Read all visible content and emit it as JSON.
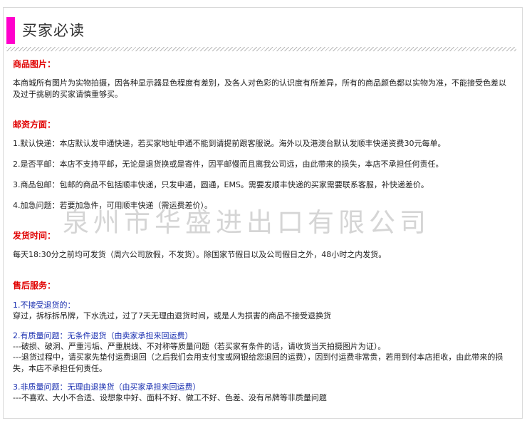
{
  "header": {
    "title": "买家必读"
  },
  "sections": {
    "photos": {
      "title": "商品图片：",
      "body": "本商城所有图片为实物拍摄，因各种显示器显色程度有差别，及各人对色彩的认识度有所差异，所有的商品颜色都以实物为准，不能接受色差以及过于挑剔的买家请慎重够买。"
    },
    "shipping_fee": {
      "title": "邮资方面：",
      "items": [
        "1.默认快递：本店默认发申通快递，若买家地址申通不能到请提前跟客服说。海外以及港澳台默认发顺丰快递资费30元每单。",
        "2.是否平邮：本店不支持平邮，无论是退货换或是寄件，因平邮慢而且离我公司远，由此带来的损失，本店不承担任何责任。",
        "3.商品包邮：包邮的商品不包括顺丰快递，只发申通，圆通，EMS。需要发顺丰快递的买家需要联系客服，补快递差价。",
        "4.加急问题：若要加急件，可用顺丰快递（需运费差价）。"
      ]
    },
    "delivery_time": {
      "title": "发货时间：",
      "body": "每天18:30分之前均可发货（周六公司放假，不发货）。除国家节假日以及公司假日之外，48小时之内发货。"
    },
    "after_sales": {
      "title": "售后服务：",
      "item1_title": "1.不接受退货的：",
      "item1_body": "穿过，拆标拆吊牌，下水洗过，过了7天无理由退货时间，或是人为损害的商品不接受退换货",
      "item2_title": "2.有质量问题：无条件退货（由卖家承担来回运费）",
      "item2_line1": "---破损、破洞、严重污垢、严重脱线、不对称等质量问题（若买家有条件的话，请收货当天拍摄图片为证）。",
      "item2_line2": "---退货过程中，请买家先垫付运费退回（之后我们会用支付宝或网银给您退回的运费），因到付运费非常贵，若用到付本店拒收，由此带来的损失，本店不承担任何责任。",
      "item3_title": "3.非质量问题：无理由退换货（由买家承担来回运费）",
      "item3_body": "---不喜欢、大小不合适、设想象中好、面料不好、做工不好、色差、没有吊牌等非质量问题"
    }
  },
  "watermark": "泉州市华盛进出口有限公司"
}
